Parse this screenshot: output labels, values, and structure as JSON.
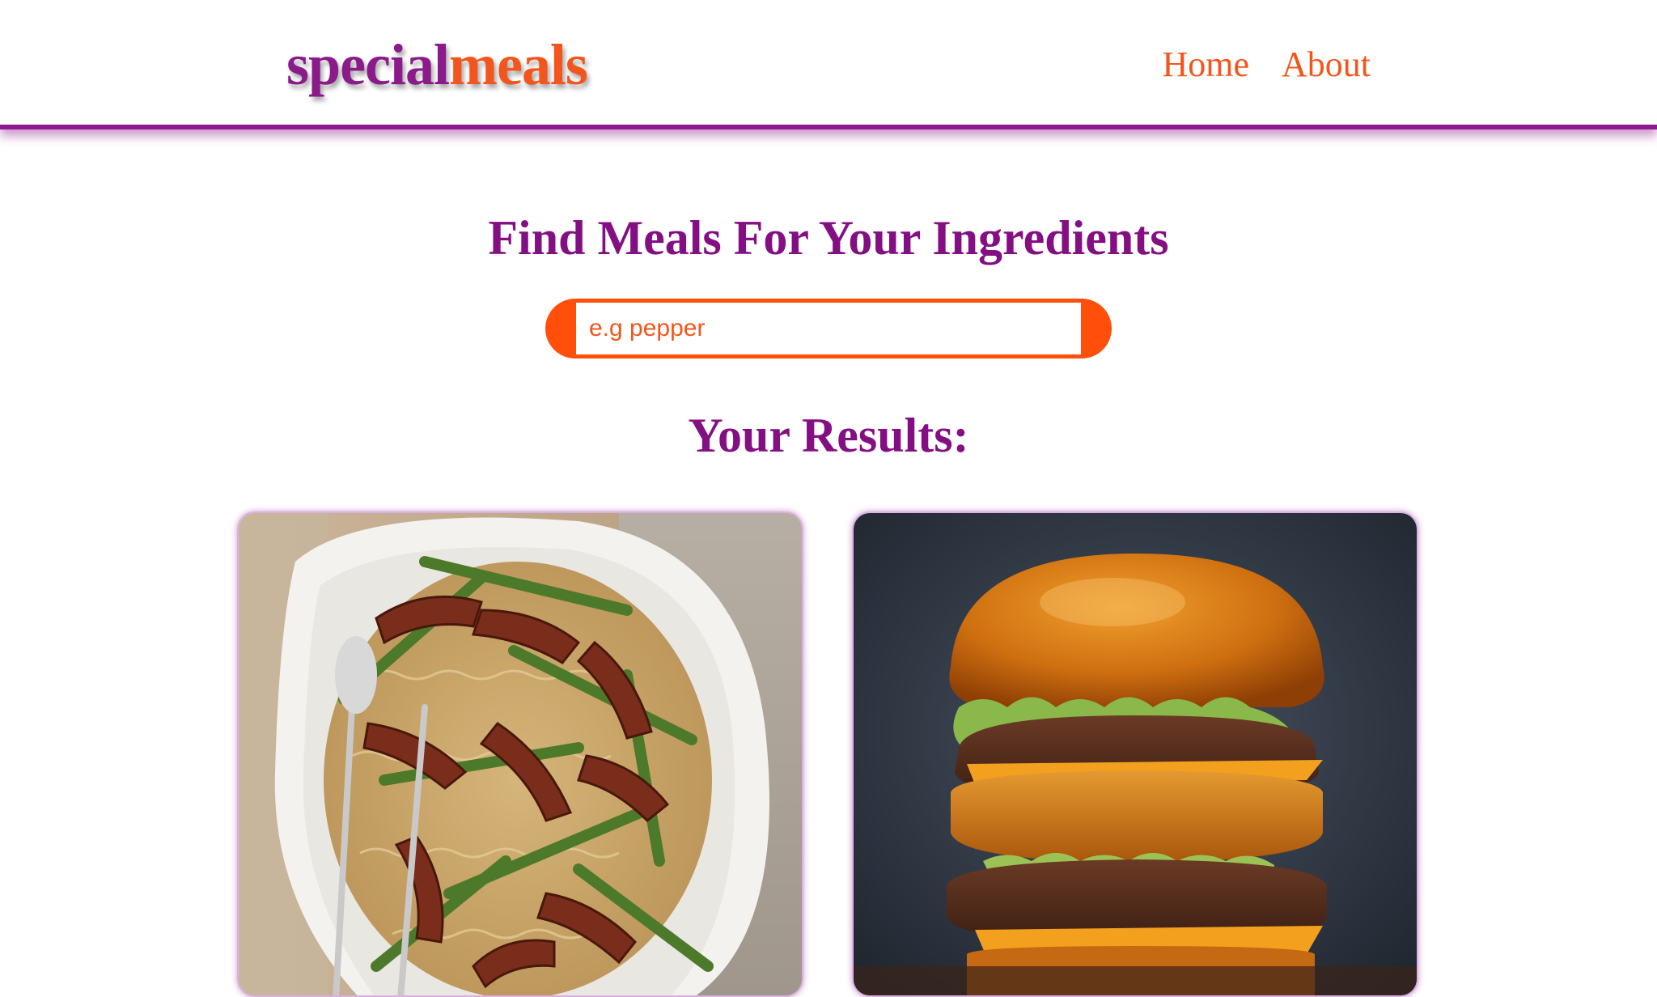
{
  "header": {
    "logo_part1": "special",
    "logo_part2": "meals",
    "nav": [
      {
        "label": "Home"
      },
      {
        "label": "About"
      }
    ]
  },
  "main": {
    "heading": "Find Meals For Your Ingredients",
    "search": {
      "placeholder": "e.g pepper",
      "value": ""
    },
    "results_title": "Your Results:"
  },
  "results": [
    {
      "image": "beef-asparagus-noodles-photo"
    },
    {
      "image": "double-cheeseburger-photo"
    }
  ],
  "colors": {
    "purple": "#830f83",
    "orange": "#f2561d",
    "search_border": "#ff4f0a"
  }
}
